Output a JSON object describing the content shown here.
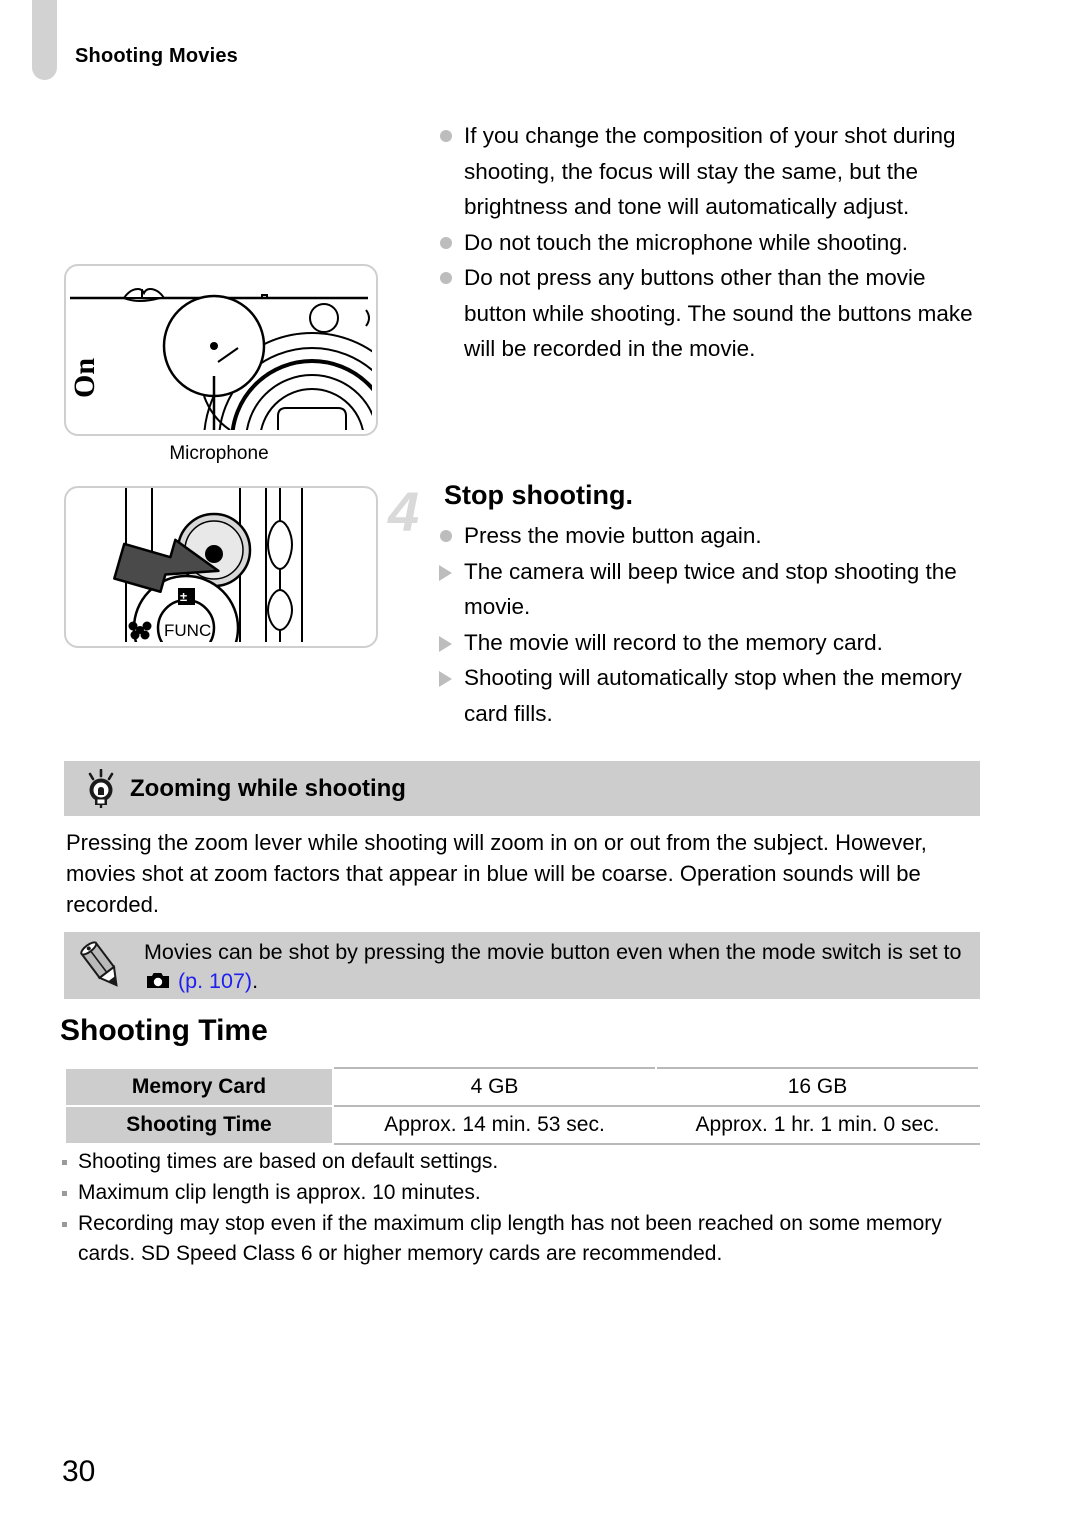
{
  "page": {
    "running_head": "Shooting Movies",
    "page_number": "30"
  },
  "figures": {
    "camera_front": {
      "name": "camera-front-illustration",
      "caption": "Microphone"
    },
    "movie_button": {
      "name": "movie-button-illustration",
      "dial_label": "FUNC"
    }
  },
  "notes_top": [
    {
      "marker": "dot",
      "text": "If you change the composition of your shot during shooting, the focus will stay the same, but the brightness and tone will automatically adjust."
    },
    {
      "marker": "dot",
      "text": "Do not touch the microphone while shooting."
    },
    {
      "marker": "dot",
      "text": "Do not press any buttons other than the movie button while shooting. The sound the buttons make will be recorded in the movie."
    }
  ],
  "step": {
    "number": "4",
    "title": "Stop shooting.",
    "items": [
      {
        "marker": "dot",
        "text": "Press the movie button again."
      },
      {
        "marker": "triangle",
        "text": "The camera will beep twice and stop shooting the movie."
      },
      {
        "marker": "triangle",
        "text": "The movie will record to the memory card."
      },
      {
        "marker": "triangle",
        "text": "Shooting will automatically stop when the memory card fills."
      }
    ]
  },
  "tip": {
    "icon": "lightbulb-icon",
    "title": "Zooming while shooting",
    "body": "Pressing the zoom lever while shooting will zoom in on or out from the subject. However, movies shot at zoom factors that appear in blue will be coarse. Operation sounds will be recorded."
  },
  "note": {
    "icon": "pencil-icon",
    "text_before": "Movies can be shot by pressing the movie button even when the mode switch is set to",
    "inline_icon": "camera-icon",
    "link_text": "(p. 107)",
    "text_after": ".",
    "link_color": "#2020ee"
  },
  "section": {
    "heading": "Shooting Time"
  },
  "table": {
    "rows": [
      {
        "header": "Memory Card",
        "cells": [
          "4 GB",
          "16 GB"
        ]
      },
      {
        "header": "Shooting Time",
        "cells": [
          "Approx. 14 min. 53 sec.",
          "Approx. 1 hr. 1 min. 0 sec."
        ]
      }
    ]
  },
  "footnotes": [
    "Shooting times are based on default settings.",
    "Maximum clip length is approx. 10 minutes.",
    "Recording may stop even if the maximum clip length has not been reached on some memory cards. SD Speed Class 6 or higher memory cards are recommended."
  ],
  "colors": {
    "tab": "#d2d2d2",
    "bullet": "#bdbdbd",
    "box_gray": "#cdcdcd",
    "step_number": "#d9d9d9",
    "link": "#2020ee"
  }
}
